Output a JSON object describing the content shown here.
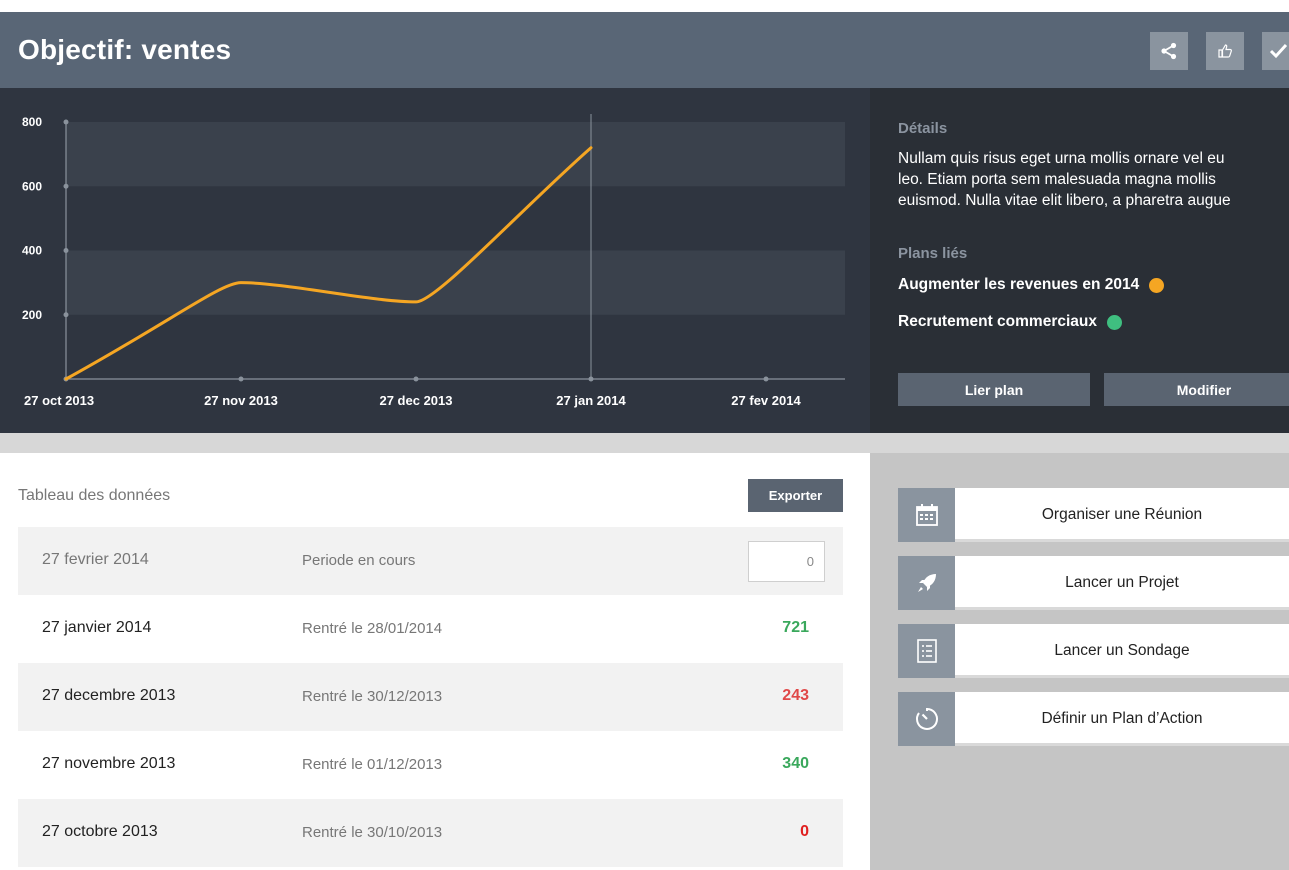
{
  "header": {
    "title": "Objectif: ventes"
  },
  "chart_data": {
    "type": "line",
    "x": [
      "27 oct 2013",
      "27 nov 2013",
      "27 dec 2013",
      "27 jan 2014",
      "27 fev 2014"
    ],
    "series": [
      {
        "values": [
          0,
          300,
          240,
          720
        ]
      }
    ],
    "ylim": [
      0,
      800
    ],
    "yticks": [
      200,
      400,
      600,
      800
    ],
    "grid": true,
    "colors": {
      "line": "#f5a623",
      "band": "#3a414c",
      "axis": "#8a929c"
    }
  },
  "details": {
    "heading": "Détails",
    "text_lines": [
      "Nullam quis risus eget urna mollis ornare vel eu",
      "leo. Etiam porta sem malesuada magna mollis",
      "euismod. Nulla vitae elit libero, a pharetra augue"
    ],
    "plans_heading": "Plans liés",
    "plans": [
      {
        "label": "Augmenter les revenues en 2014",
        "color": "#f5a623"
      },
      {
        "label": "Recrutement commerciaux",
        "color": "#3fbf80"
      }
    ],
    "link_button": "Lier plan",
    "edit_button": "Modifier"
  },
  "table": {
    "title": "Tableau des données",
    "export_button": "Exporter",
    "current": {
      "date": "27 fevrier 2014",
      "note": "Periode en cours",
      "input_value": "0"
    },
    "rows": [
      {
        "date": "27 janvier 2014",
        "note": "Rentré le 28/01/2014",
        "value": "721",
        "color": "#3aa85c"
      },
      {
        "date": "27 decembre 2013",
        "note": "Rentré le 30/12/2013",
        "value": "243",
        "color": "#e04848"
      },
      {
        "date": "27 novembre 2013",
        "note": "Rentré le 01/12/2013",
        "value": "340",
        "color": "#3aa85c"
      },
      {
        "date": "27 octobre 2013",
        "note": "Rentré le 30/10/2013",
        "value": "0",
        "color": "#e02020"
      }
    ]
  },
  "actions": [
    {
      "label": "Organiser une Réunion",
      "icon": "calendar-icon"
    },
    {
      "label": "Lancer un Projet",
      "icon": "rocket-icon"
    },
    {
      "label": "Lancer un Sondage",
      "icon": "list-icon"
    },
    {
      "label": "Définir un Plan d’Action",
      "icon": "timer-icon"
    }
  ]
}
